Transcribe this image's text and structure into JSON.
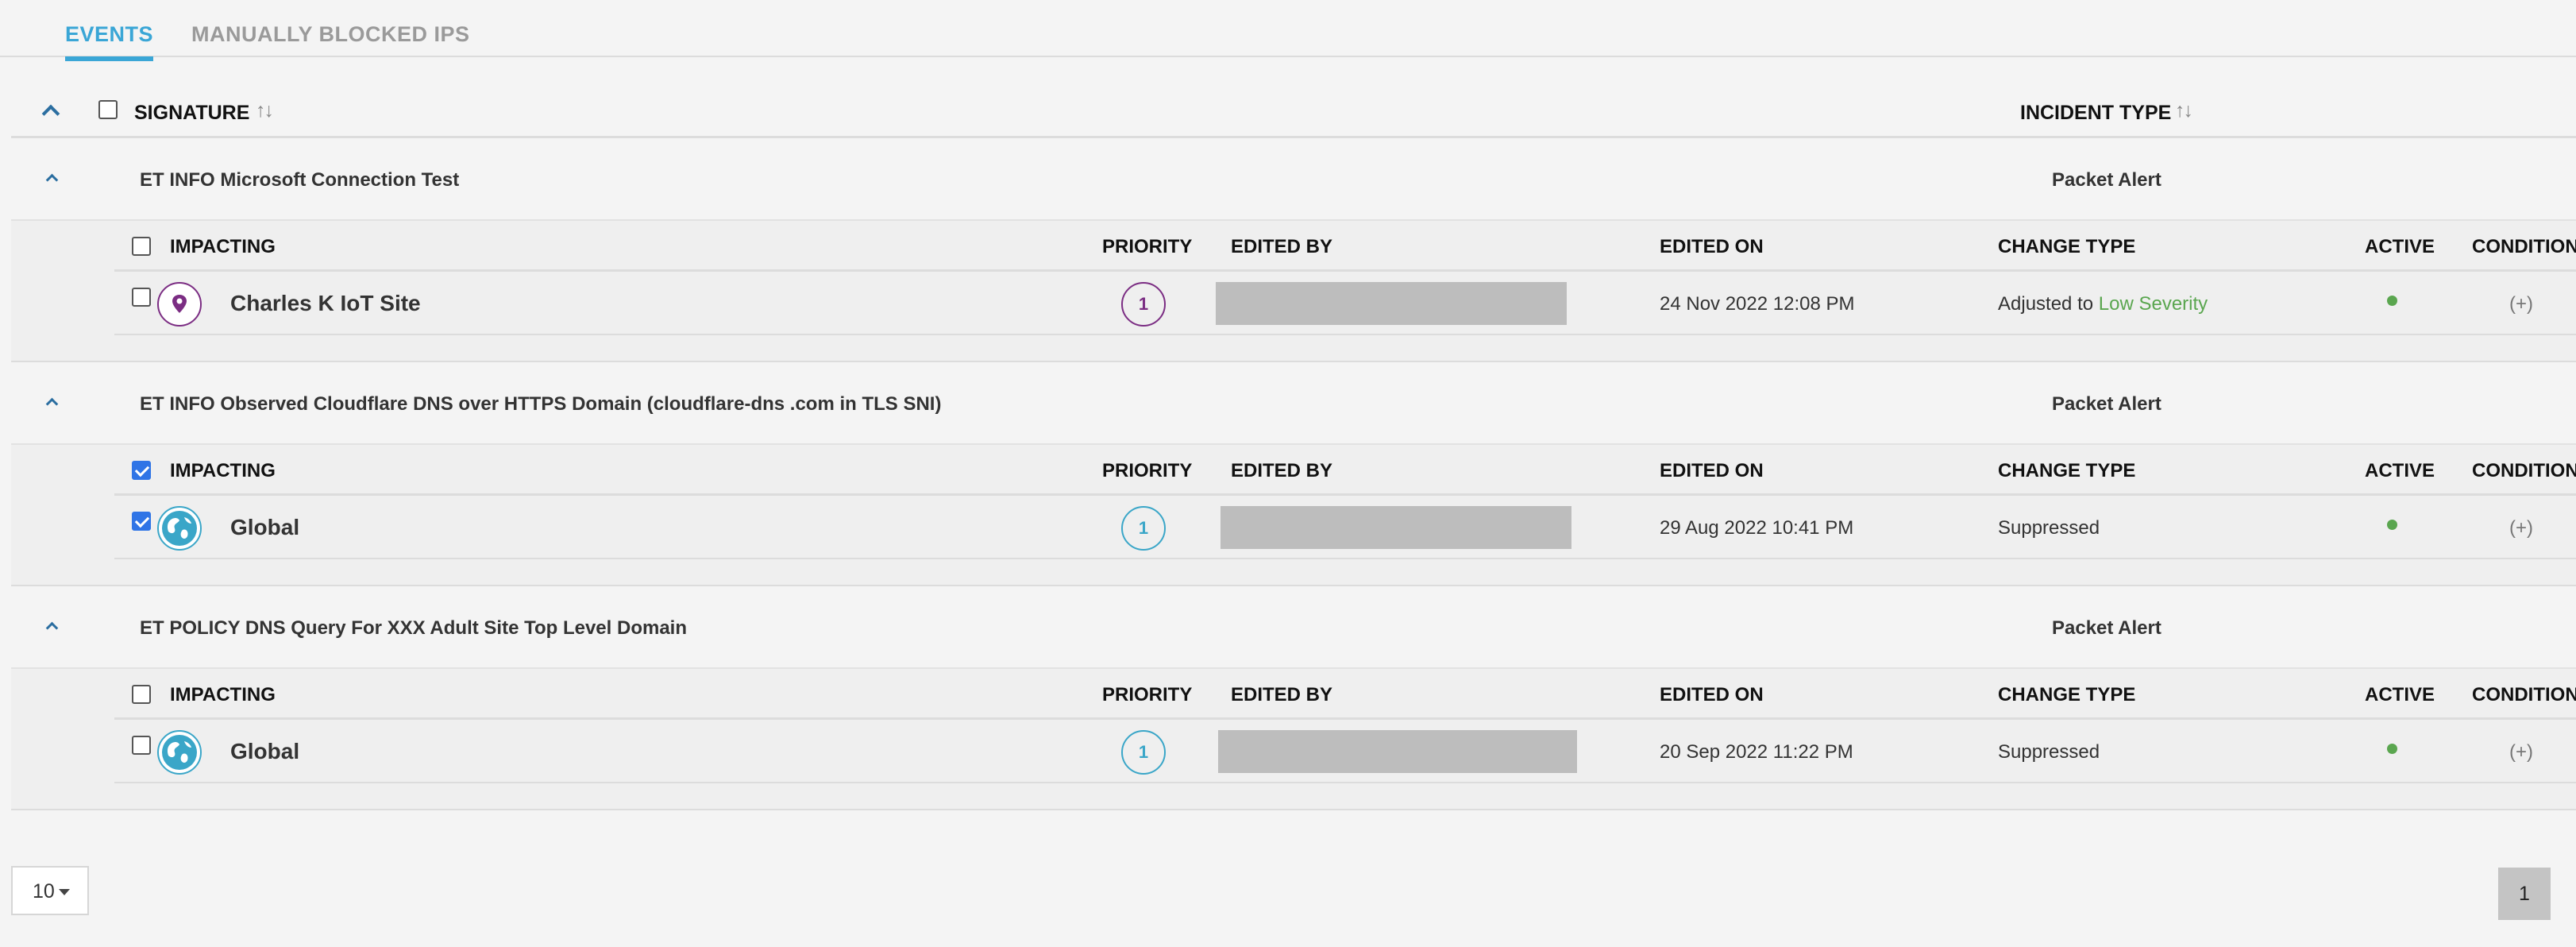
{
  "tabs": {
    "events": "EVENTS",
    "manually_blocked": "MANUALLY BLOCKED IPS"
  },
  "header": {
    "signature": "SIGNATURE",
    "incident_type": "INCIDENT TYPE",
    "sort_icon": "↑↓"
  },
  "columns": {
    "impacting": "IMPACTING",
    "priority": "PRIORITY",
    "edited_by": "EDITED BY",
    "edited_on": "EDITED ON",
    "change_type": "CHANGE TYPE",
    "active": "ACTIVE",
    "condition": "CONDITION"
  },
  "signatures": [
    {
      "name": "ET INFO Microsoft Connection Test",
      "incident_type": "Packet Alert",
      "row": {
        "site_icon": "location-pin-icon",
        "site": "Charles K IoT Site",
        "priority": "1",
        "edited_on": "24 Nov 2022 12:08 PM",
        "change_prefix": "Adjusted to",
        "change_highlight": "Low Severity",
        "condition": "(+)",
        "checked": false,
        "active": true
      }
    },
    {
      "name": "ET INFO Observed Cloudflare DNS over HTTPS Domain (cloudflare-dns .com in TLS SNI)",
      "incident_type": "Packet Alert",
      "row": {
        "site_icon": "globe-icon",
        "site": "Global",
        "priority": "1",
        "edited_on": "29 Aug 2022 10:41 PM",
        "change_prefix": "Suppressed",
        "change_highlight": "",
        "condition": "(+)",
        "checked": true,
        "active": true
      }
    },
    {
      "name": "ET POLICY DNS Query For XXX Adult Site Top Level Domain",
      "incident_type": "Packet Alert",
      "row": {
        "site_icon": "globe-icon",
        "site": "Global",
        "priority": "1",
        "edited_on": "20 Sep 2022 11:22 PM",
        "change_prefix": "Suppressed",
        "change_highlight": "",
        "condition": "(+)",
        "checked": false,
        "active": true
      }
    }
  ],
  "pagination": {
    "page_size": "10",
    "current_page": "1"
  },
  "colors": {
    "accent": "#3aa6d6",
    "purple": "#7b2d83",
    "teal": "#3aa6c8",
    "active_green": "#5aa64f",
    "checkbox_blue": "#2f74e6"
  }
}
